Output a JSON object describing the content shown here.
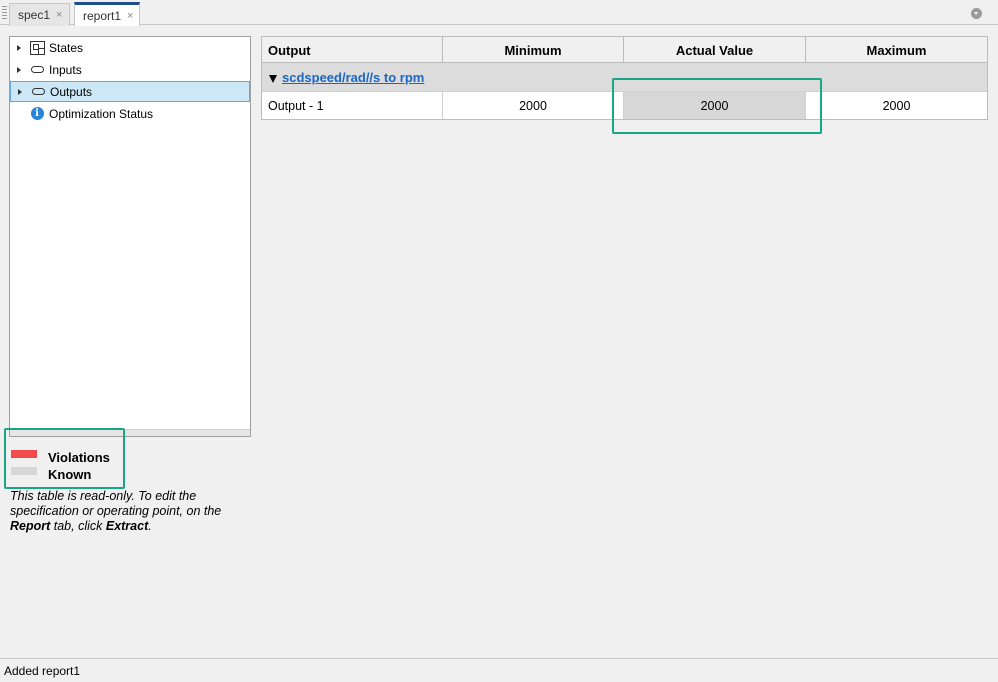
{
  "tabs": [
    {
      "label": "spec1",
      "close": "×"
    },
    {
      "label": "report1",
      "close": "×"
    }
  ],
  "tree": {
    "items": [
      {
        "label": "States",
        "icon": "states-block-icon",
        "expandable": true
      },
      {
        "label": "Inputs",
        "icon": "input-port-icon",
        "expandable": true
      },
      {
        "label": "Outputs",
        "icon": "output-port-icon",
        "expandable": true,
        "selected": true
      },
      {
        "label": "Optimization Status",
        "icon": "info-icon",
        "expandable": false
      }
    ]
  },
  "legend": {
    "violations": {
      "label": "Violations",
      "color": "#f24b4b"
    },
    "known": {
      "label": "Known",
      "color": "#d7d7d7"
    }
  },
  "note": {
    "part1": "This table is read-only. To edit the specification or operating point, on the ",
    "report": "Report",
    "part2": " tab, click ",
    "extract": "Extract",
    "part3": "."
  },
  "table": {
    "headers": [
      "Output",
      "Minimum",
      "Actual Value",
      "Maximum"
    ],
    "group": "scdspeed/rad//s to rpm",
    "rows": [
      {
        "name": "Output - 1",
        "minimum": "2000",
        "actual": "2000",
        "maximum": "2000"
      }
    ]
  },
  "colors": {
    "highlight": "#1aa686",
    "selection": "#cce8f7",
    "link": "#1a67c4"
  },
  "status": {
    "text": "Added report1"
  }
}
